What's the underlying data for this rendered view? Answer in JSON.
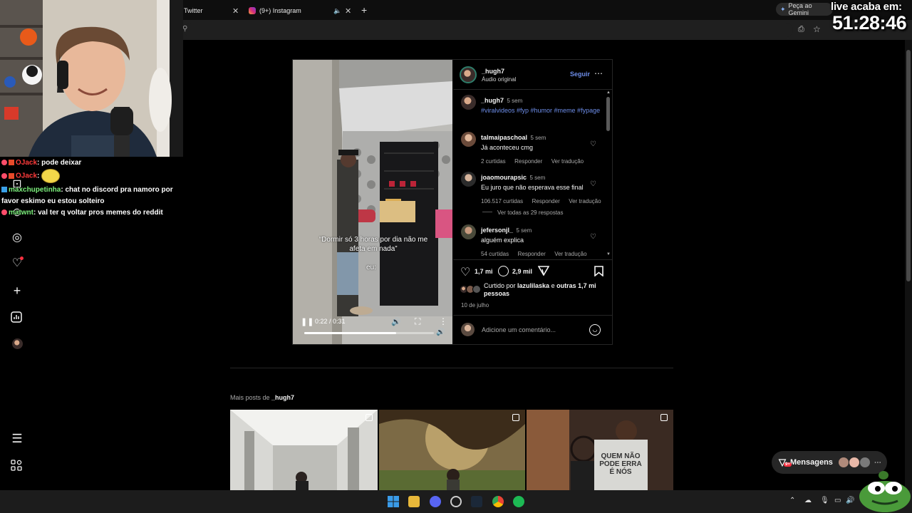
{
  "browser": {
    "tabs": [
      {
        "label": "Twitter"
      },
      {
        "label": "(9+) Instagram"
      }
    ],
    "new_tab": "+",
    "gemini_button": "Peça ao Gemini"
  },
  "overlay": {
    "live_label": "live acaba em:",
    "live_timer": "51:28:46"
  },
  "chat": [
    {
      "user": "OJack",
      "text": "pode deixar",
      "color": "#ff3b3b"
    },
    {
      "user": "OJack",
      "text": "",
      "color": "#ff3b3b",
      "emote": "glasses-emote"
    },
    {
      "user": "maxchupetinha",
      "text": "chat no discord pra namoro por favor eskimo eu estou solteiro",
      "color": "#7cf07c"
    },
    {
      "user": "matwnt",
      "text": "val ter q voltar pros memes do reddit",
      "color": "#7cf07c"
    }
  ],
  "post": {
    "author": "_hugh7",
    "audio": "Áudio original",
    "follow_label": "Seguir",
    "caption_video": "“Dormir só 3 horas por dia não me afeta em nada”",
    "caption_eu": "eu:",
    "video_time": "0:22 / 0:31",
    "video_progress": 0.71,
    "main_comment": {
      "user": "_hugh7",
      "age": "5 sem",
      "hashtags": "#viralvideos #fyp #humor #meme #fypage"
    },
    "comments": [
      {
        "user": "talmaipaschoal",
        "age": "5 sem",
        "text": "Já aconteceu cmg",
        "likes": "2 curtidas",
        "reply": "Responder",
        "translate": "Ver tradução"
      },
      {
        "user": "joaomourapsic",
        "age": "5 sem",
        "text": "Eu juro que não esperava esse final",
        "likes": "106.517 curtidas",
        "reply": "Responder",
        "translate": "Ver tradução",
        "replies": "Ver todas as 29 respostas"
      },
      {
        "user": "jefersonjl_",
        "age": "5 sem",
        "text": "alguém explica",
        "likes": "54 curtidas",
        "reply": "Responder",
        "translate": "Ver tradução"
      }
    ],
    "likes_count": "1,7 mi",
    "comments_count": "2,9 mil",
    "liked_by_prefix": "Curtido por ",
    "liked_by_user": "lazulilaska",
    "liked_by_suffix": " e ",
    "liked_by_others": "outras 1,7 mi pessoas",
    "date": "10 de julho",
    "comment_placeholder": "Adicione um comentário..."
  },
  "more_posts": {
    "label_prefix": "Mais posts de ",
    "label_user": "_hugh7",
    "thumb_text": "QUEM NÃO PODE ERRA É NÓS"
  },
  "messages": {
    "label": "Mensagens",
    "badge": "9+"
  },
  "colors": {
    "link_blue": "#6d8de8",
    "follow_blue": "#4a5ee8",
    "background": "#000000"
  }
}
